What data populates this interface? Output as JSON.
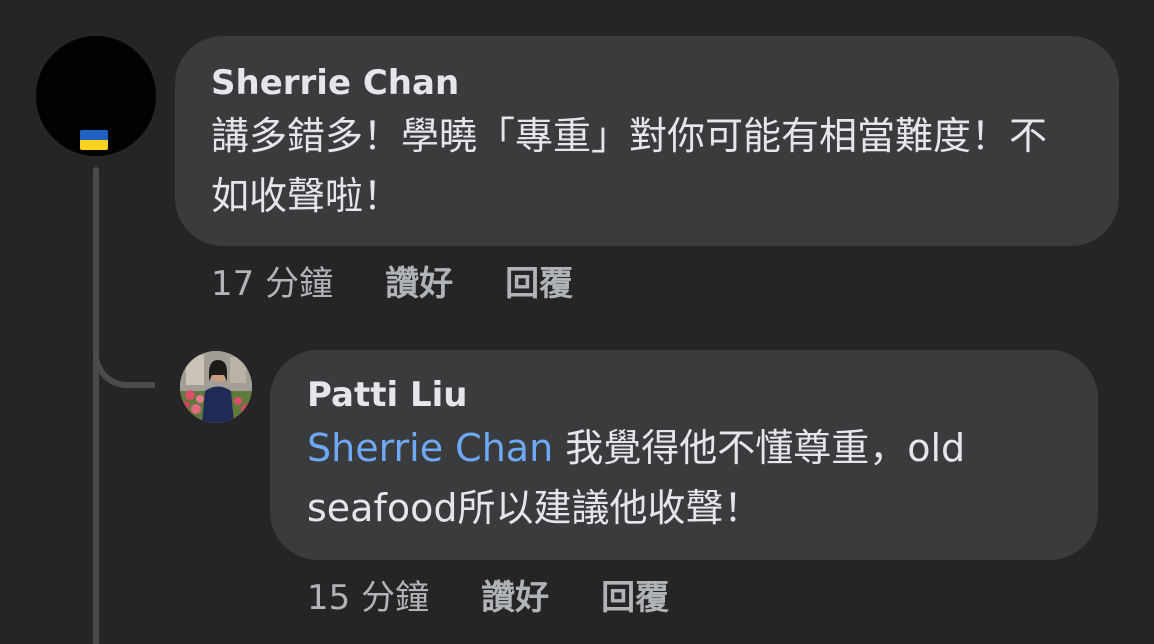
{
  "comments": [
    {
      "author": "Sherrie Chan",
      "text": "講多錯多！學曉「專重」對你可能有相當難度！不如收聲啦！",
      "time": "17 分鐘",
      "like_label": "讚好",
      "reply_label": "回覆"
    }
  ],
  "reply": {
    "author": "Patti Liu",
    "mention": "Sherrie Chan",
    "text": " 我覺得他不懂尊重，old seafood所以建議他收聲！",
    "time": "15 分鐘",
    "like_label": "讚好",
    "reply_label": "回覆"
  },
  "colors": {
    "background": "#252526",
    "bubble": "#3a3b3c",
    "text": "#e4e6eb",
    "meta_text": "#b0b3b8",
    "mention": "#6fa8f5",
    "thread_line": "#4a4b4d",
    "flag_blue": "#1f61c2",
    "flag_yellow": "#ffd21f"
  },
  "icons": {
    "main_avatar_badge": "ukraine-flag-icon"
  }
}
